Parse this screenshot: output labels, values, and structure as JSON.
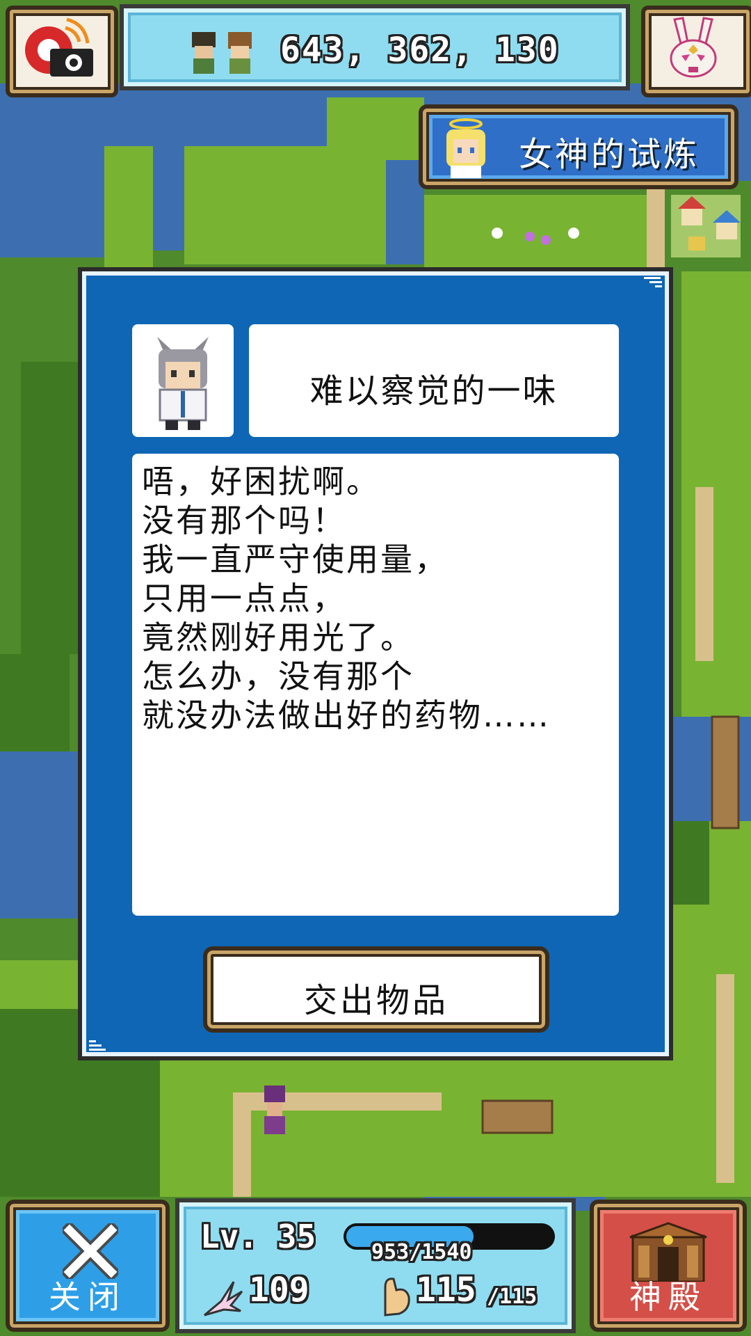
{
  "top_bar": {
    "camera_icon": "camera-icon",
    "coordinates": "643, 362, 130",
    "party_icon": "party-members-icon",
    "rabbit_icon": "rabbit-mask-icon"
  },
  "quest": {
    "label": "女神的试炼",
    "portrait_icon": "goddess-portrait-icon"
  },
  "dialog": {
    "npc_icon": "cat-eared-scientist-portrait",
    "title": "难以察觉的一味",
    "lines": [
      "唔，好困扰啊。",
      "没有那个吗！",
      "我一直严守使用量，",
      "只用一点点，",
      "竟然刚好用光了。",
      "怎么办，没有那个",
      "就没办法做出好的药物……"
    ],
    "handover_label": "交出物品"
  },
  "bottom_bar": {
    "close_label": "关闭",
    "shrine_label": "神殿",
    "level": "Lv. 35",
    "exp_current": 953,
    "exp_max": 1540,
    "exp_text": "953/1540",
    "attack": "109",
    "hp": "115",
    "hp_max": "/115"
  },
  "colors": {
    "dialog_blue": "#0e66b5",
    "panel_cyan": "#8fdcf0",
    "close_blue": "#2e9fe6",
    "shrine_red": "#d44f47",
    "grass": "#4f8a2c",
    "water": "#3d6fb0"
  }
}
